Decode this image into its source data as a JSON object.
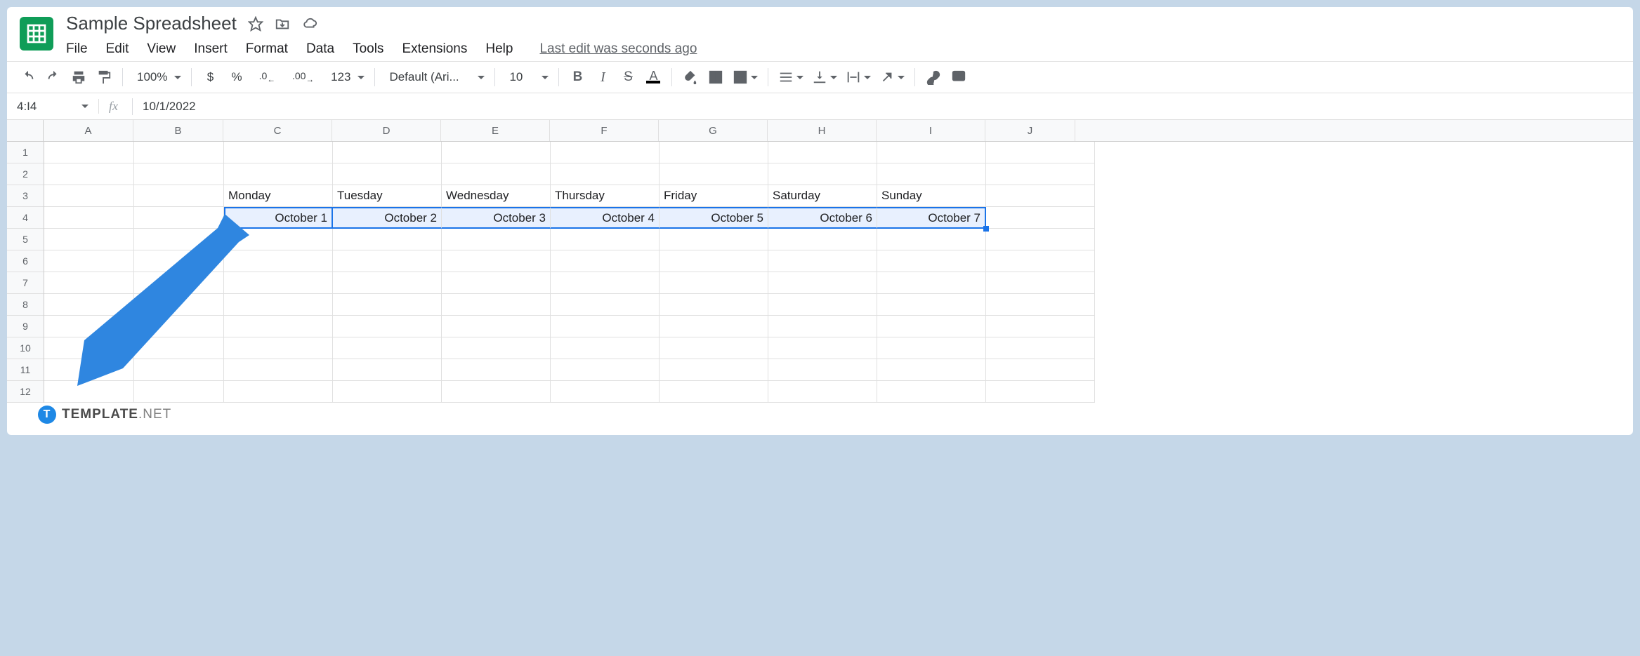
{
  "header": {
    "title": "Sample Spreadsheet",
    "menus": [
      "File",
      "Edit",
      "View",
      "Insert",
      "Format",
      "Data",
      "Tools",
      "Extensions",
      "Help"
    ],
    "last_edit": "Last edit was seconds ago"
  },
  "toolbar": {
    "zoom": "100%",
    "font": "Default (Ari...",
    "font_size": "10",
    "currency": "$",
    "percent": "%",
    "dec_dec": ".0",
    "inc_dec": ".00",
    "num_fmt": "123",
    "bold": "B",
    "italic": "I",
    "strike": "S",
    "text_color": "A"
  },
  "formula": {
    "name_box": "4:I4",
    "fx": "fx",
    "value": "10/1/2022"
  },
  "columns": [
    "A",
    "B",
    "C",
    "D",
    "E",
    "F",
    "G",
    "H",
    "I",
    "J"
  ],
  "row_count": 12,
  "cells": {
    "row3": [
      "",
      "",
      "Monday",
      "Tuesday",
      "Wednesday",
      "Thursday",
      "Friday",
      "Saturday",
      "Sunday",
      ""
    ],
    "row4": [
      "",
      "",
      "October 1",
      "October 2",
      "October 3",
      "October 4",
      "October 5",
      "October 6",
      "October 7",
      ""
    ]
  },
  "watermark": {
    "icon": "T",
    "brand": "TEMPLATE",
    "suffix": ".NET"
  }
}
